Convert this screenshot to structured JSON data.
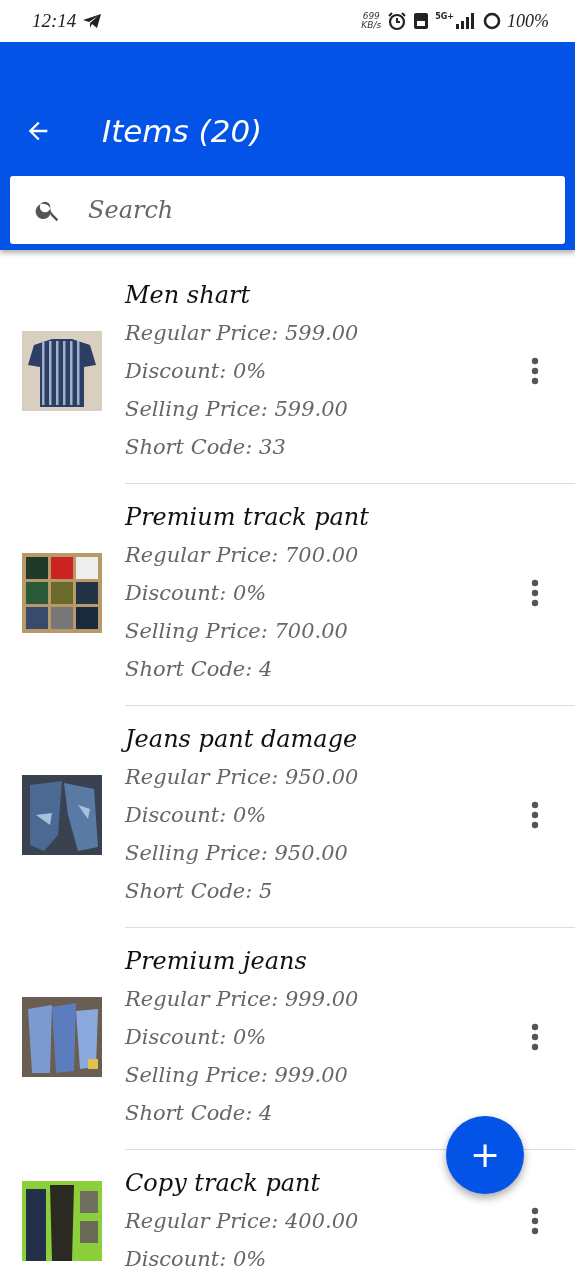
{
  "status_bar": {
    "time": "12:14",
    "speed_value": "699",
    "speed_unit": "KB/s",
    "network": "5G+",
    "battery": "100%"
  },
  "app_bar": {
    "title": "Items (20)"
  },
  "search": {
    "placeholder": "Search"
  },
  "items": [
    {
      "name": "Men shart",
      "details": [
        "Regular Price: 599.00",
        "Discount: 0%",
        "Selling Price: 599.00",
        "Short Code: 33"
      ]
    },
    {
      "name": "Premium track pant",
      "details": [
        "Regular Price: 700.00",
        "Discount: 0%",
        "Selling Price: 700.00",
        "Short Code: 4"
      ]
    },
    {
      "name": "Jeans pant damage",
      "details": [
        "Regular Price: 950.00",
        "Discount: 0%",
        "Selling Price: 950.00",
        "Short Code: 5"
      ]
    },
    {
      "name": "Premium jeans",
      "details": [
        "Regular Price: 999.00",
        "Discount: 0%",
        "Selling Price: 999.00",
        "Short Code: 4"
      ]
    },
    {
      "name": "Copy track pant",
      "details": [
        "Regular Price: 400.00",
        "Discount: 0%"
      ]
    }
  ],
  "fab": {
    "label": "+"
  }
}
